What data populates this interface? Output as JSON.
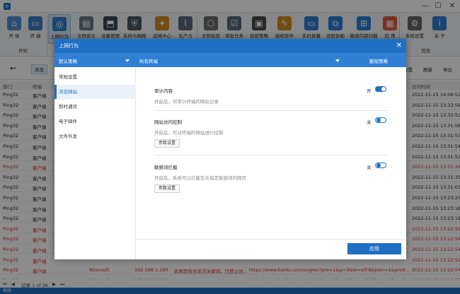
{
  "titlebar": {
    "app_icon": "app-logo-icon",
    "minimize": "—",
    "maximize": "☐",
    "close": "✕"
  },
  "ribbon": {
    "groups": {
      "start": "开始",
      "other": "其他"
    },
    "buttons": [
      {
        "label": "开 始",
        "icon": "home-icon",
        "color": "#4a8fd8",
        "glyph": "⌂"
      },
      {
        "label": "终 端",
        "icon": "monitor-icon",
        "color": "#3a7fc8",
        "glyph": "▭"
      },
      {
        "label": "上网行为",
        "icon": "globe-icon",
        "color": "#2f7fd4",
        "glyph": "◎"
      },
      {
        "label": "文档安全",
        "icon": "document-icon",
        "color": "#6a7a8c",
        "glyph": "▤"
      },
      {
        "label": "设备管理",
        "icon": "usb-icon",
        "color": "#3c4a5a",
        "glyph": "⬒"
      },
      {
        "label": "系统与网络",
        "icon": "shield-icon",
        "color": "#4a5868",
        "glyph": "⛨"
      },
      {
        "label": "运维中心",
        "icon": "wand-icon",
        "color": "#d08a20",
        "glyph": "✦"
      },
      {
        "label": "生产力",
        "icon": "chart-icon",
        "color": "#5a6a7a",
        "glyph": "⌇"
      },
      {
        "label": "文档加密",
        "icon": "encrypt-icon",
        "color": "#6a6a6a",
        "glyph": "⬡"
      },
      {
        "label": "审批任务",
        "icon": "checklist-icon",
        "color": "#5a6a7a",
        "glyph": "☑"
      },
      {
        "label": "加密策略",
        "icon": "lock-icon",
        "color": "#4a4a4a",
        "glyph": "▣"
      },
      {
        "label": "授权软件",
        "icon": "pen-icon",
        "color": "#d08a20",
        "glyph": "✎"
      },
      {
        "label": "实时屏幕",
        "icon": "screen-icon",
        "color": "#2f7fd4",
        "glyph": "▭"
      },
      {
        "label": "远程协助",
        "icon": "remote-icon",
        "color": "#2f7fd4",
        "glyph": "⧉"
      },
      {
        "label": "敏感内容扫描",
        "icon": "scan-icon",
        "color": "#2f7fd4",
        "glyph": "⊞"
      },
      {
        "label": "应 用",
        "icon": "apps-icon",
        "color": "#e05a3a",
        "glyph": "▦"
      },
      {
        "label": "系统设置",
        "icon": "gear-icon",
        "color": "#666666",
        "glyph": "⚙"
      },
      {
        "label": "关 于",
        "icon": "info-icon",
        "color": "#2f7fd4",
        "glyph": "i"
      }
    ]
  },
  "toolbar2": {
    "back": "←",
    "browse_chip": "浏览",
    "settings": "设置",
    "refresh": "刷新",
    "export": "导出"
  },
  "table": {
    "columns": [
      "部门",
      "终端",
      "访问时间"
    ],
    "rows": [
      {
        "dept": "Ping32",
        "term": "客户端",
        "time": "2022-11-15 14:06:52",
        "red": false
      },
      {
        "dept": "Ping32",
        "term": "客户端",
        "time": "2022-11-15 13:32:59",
        "red": false
      },
      {
        "dept": "Ping32",
        "term": "客户端",
        "time": "2022-11-15 13:32:53",
        "red": false
      },
      {
        "dept": "Ping32",
        "term": "客户端",
        "time": "2022-11-15 13:31:58",
        "red": false
      },
      {
        "dept": "Ping32",
        "term": "客户端",
        "time": "2022-11-15 13:31:57",
        "red": false
      },
      {
        "dept": "Ping32",
        "term": "客户端",
        "time": "2022-11-15 13:31:54",
        "red": false
      },
      {
        "dept": "Ping32",
        "term": "客户端",
        "time": "2022-11-15 13:31:51",
        "red": false
      },
      {
        "dept": "Ping32",
        "term": "客户端",
        "time": "2022-11-15 13:31:34",
        "red": true
      },
      {
        "dept": "Ping32",
        "term": "客户端",
        "time": "2022-11-15 13:31:33",
        "red": false
      },
      {
        "dept": "Ping32",
        "term": "客户端",
        "time": "2022-11-15 13:31:03",
        "red": false
      },
      {
        "dept": "Ping32",
        "term": "客户端",
        "time": "2022-11-15 13:23:25",
        "red": false
      },
      {
        "dept": "Ping32",
        "term": "客户端",
        "time": "2022-11-15 13:23:18",
        "red": false
      },
      {
        "dept": "Ping32",
        "term": "客户端",
        "time": "2022-11-15 13:23:16",
        "red": false
      },
      {
        "dept": "Ping32",
        "term": "客户端",
        "time": "2022-11-15 13:22:55",
        "red": true
      },
      {
        "dept": "Ping32",
        "term": "客户端",
        "time": "2022-11-15 13:22:54",
        "red": true
      },
      {
        "dept": "Ping32",
        "term": "客户端",
        "time": "2022-11-15 13:22:54",
        "red": true
      },
      {
        "dept": "Ping32",
        "term": "客户端",
        "time": "2022-11-15 13:22:52",
        "red": true
      }
    ],
    "visible_row1": {
      "dept": "Ping32",
      "term": "客户端",
      "user": "NSecsoft",
      "ip": "192.168.1.190",
      "note": "此网页包含非法关键词，已禁止访...",
      "url": "https://www.baidu.com/sugrec?pre=1&p=3&ie=utf-8&json=1&prod...",
      "time": "2022-11-15 13:22:54"
    },
    "visible_row2": {
      "dept": "Ping32",
      "term": "客户端",
      "user": "NSecsoft",
      "ip": "192.168.1.190",
      "note": "此网页包含非法关键词，已禁止访...",
      "url": "https://www.baidu.com/sugrec?pre=1&p=3&ie=utf-8&json=1&prod...",
      "time": "2022-11-15 13:22:52"
    }
  },
  "pagination": {
    "text": "记录 1 of 26"
  },
  "bottombar": {
    "text": "就绪"
  },
  "dialog": {
    "title": "上网行为",
    "close": "✕",
    "header": {
      "policy": "默认策略",
      "terminals": "所有终端",
      "delete": "删除策略"
    },
    "sidebar": [
      "常规设置",
      "浏览网站",
      "即时通讯",
      "电子邮件",
      "文件外发"
    ],
    "active_index": 1,
    "settings": [
      {
        "title": "审计内容",
        "desc": "开启后，可审计终端的网站记录",
        "toggle_label": "开",
        "on": true,
        "button": ""
      },
      {
        "title": "网站访问控制",
        "desc": "开启后，可对终端的网站进行控制",
        "toggle_label": "关",
        "on": false,
        "button": "参数设置"
      },
      {
        "title": "敏感词拦截",
        "desc": "开启后，系统可以拦截包含指定敏感词的网页",
        "toggle_label": "关",
        "on": false,
        "button": "参数设置"
      }
    ],
    "apply": "应用"
  }
}
